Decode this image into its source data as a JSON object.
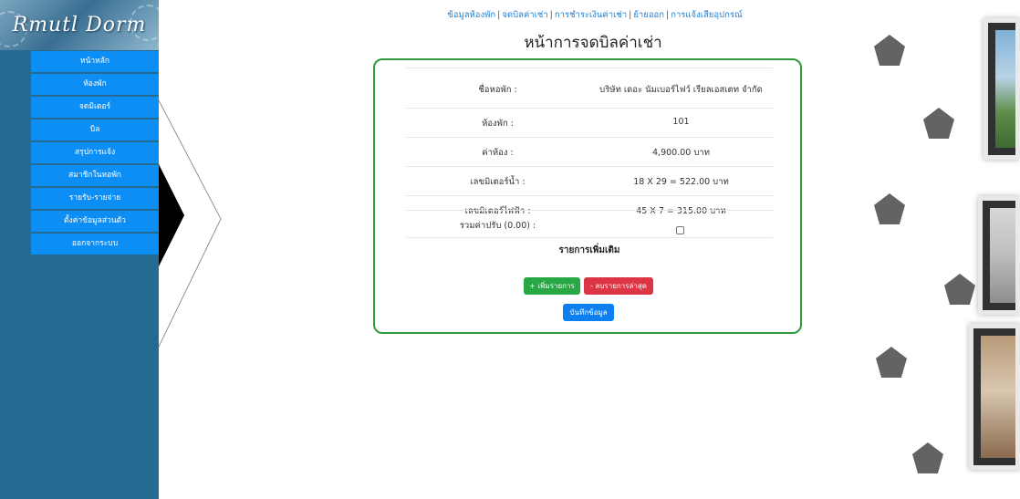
{
  "sidebar": {
    "logo": "Rmutl Dorm",
    "items": [
      {
        "label": "หน้าหลัก"
      },
      {
        "label": "ห้องพัก"
      },
      {
        "label": "จดมิเตอร์"
      },
      {
        "label": "บิล"
      },
      {
        "label": "สรุปการแจ้ง"
      },
      {
        "label": "สมาชิกในหอพัก"
      },
      {
        "label": "รายรับ-รายจ่าย"
      },
      {
        "label": "ตั้งค่าข้อมูลส่วนตัว"
      },
      {
        "label": "ออกจากระบบ"
      }
    ]
  },
  "topnav": {
    "links": [
      "ข้อมูลห้องพัก",
      "จดบิลค่าเช่า",
      "การชำระเงินค่าเช่า",
      "ย้ายออก",
      "การแจ้งเสียอุปกรณ์"
    ],
    "separator": "|"
  },
  "page_title": "หน้าการจดบิลค่าเช่า",
  "form": {
    "rows": [
      {
        "label": "ชื่อหอพัก :",
        "value": "บริษัท เดอะ นัมเบอร์ไฟว์ เรียลเอสเตท จำกัด"
      },
      {
        "label": "ห้องพัก :",
        "value": "101"
      },
      {
        "label": "ค่าห้อง :",
        "value": "4,900.00 บาท"
      },
      {
        "label": "เลขมิเตอร์น้ำ :",
        "value": "18 X 29 = 522.00 บาท"
      },
      {
        "label": "เลขมิเตอร์ไฟฟ้า :",
        "value": "45 X 7 = 315.00 บาท"
      },
      {
        "label": "รวมค่าปรับ (0.00) :",
        "checked": false
      }
    ],
    "extra_title": "รายการเพิ่มเติม",
    "add_button": "+ เพิ่มรายการ",
    "remove_button": "- ลบรายการล่าสุด",
    "save_button": "บันทึกข้อมูล"
  },
  "colors": {
    "sidebar_bg": "#246a93",
    "menu_item": "#0d8ef5",
    "card_border": "#2e9c3a",
    "add": "#28a745",
    "remove": "#dc3545",
    "save": "#0d7ff0"
  }
}
